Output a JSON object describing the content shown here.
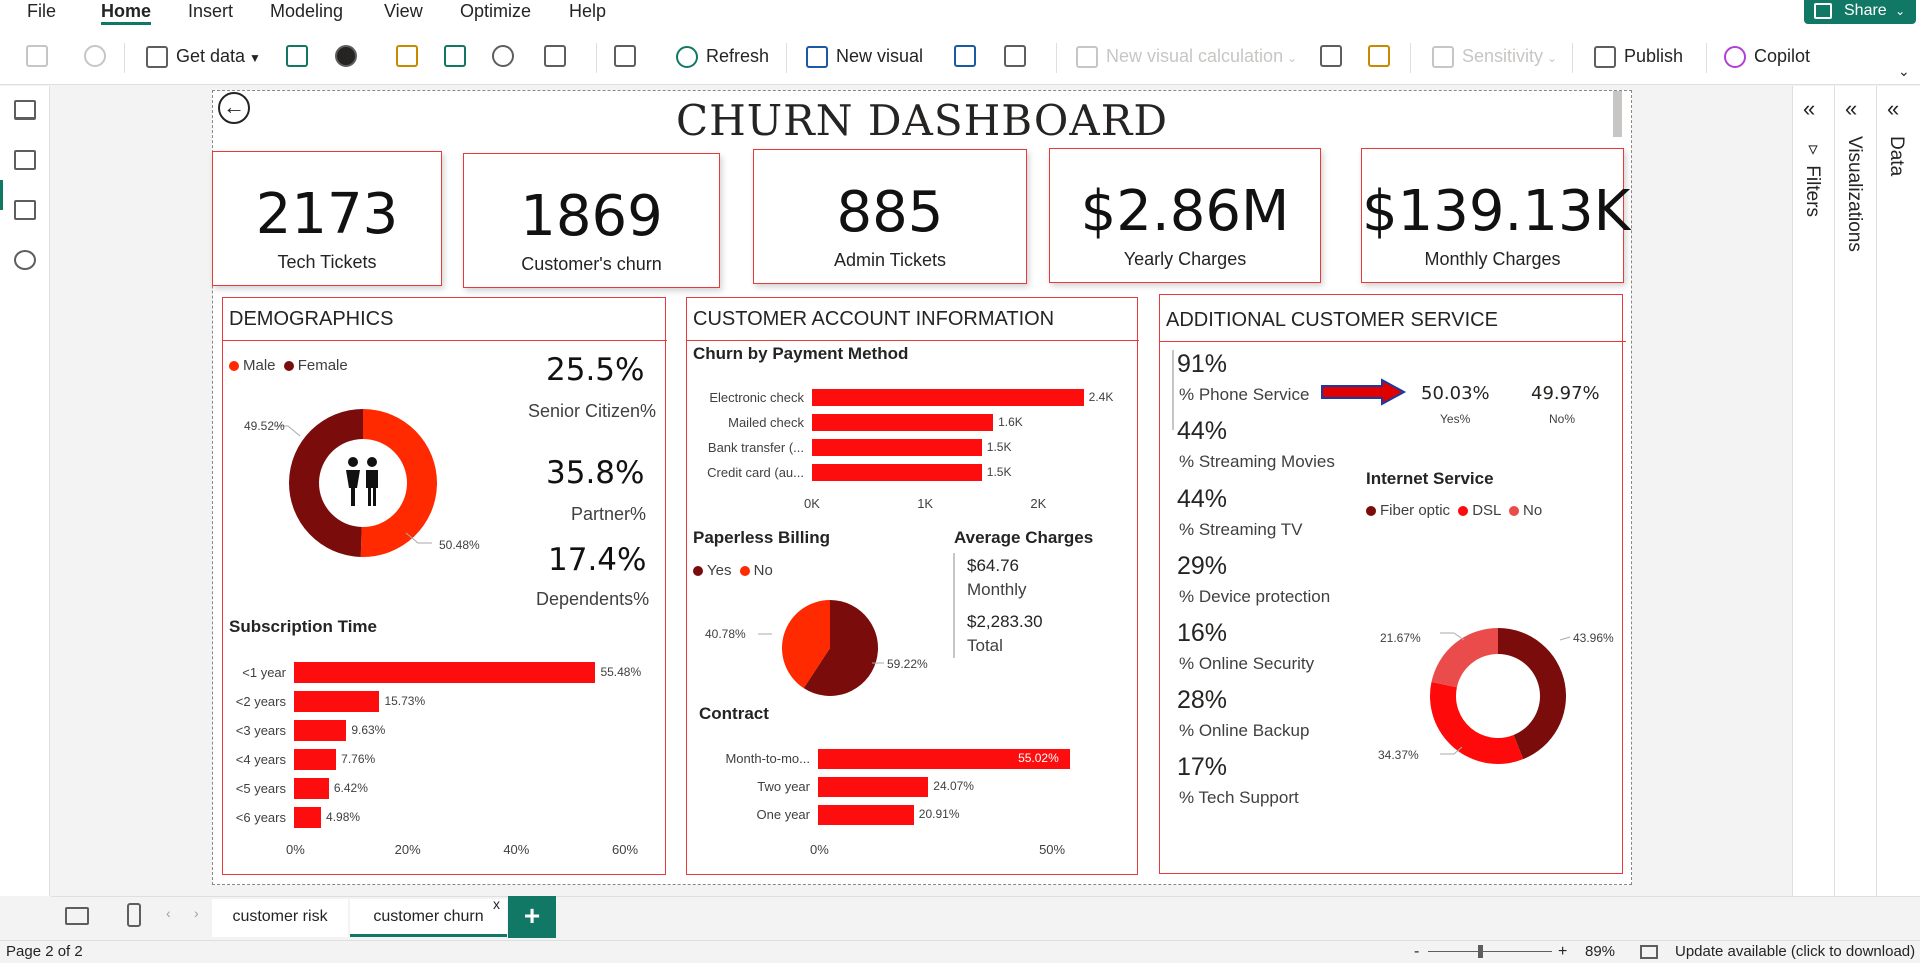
{
  "menu": [
    "File",
    "Home",
    "Insert",
    "Modeling",
    "View",
    "Optimize",
    "Help"
  ],
  "share_label": "Share",
  "ribbon": {
    "get_data": "Get data",
    "refresh": "Refresh",
    "new_visual": "New visual",
    "new_visual_calc": "New visual calculation",
    "sensitivity": "Sensitivity",
    "publish": "Publish",
    "copilot": "Copilot"
  },
  "panes": {
    "filters": "Filters",
    "visualizations": "Visualizations",
    "data": "Data"
  },
  "report": {
    "title": "CHURN DASHBOARD",
    "kpis": [
      {
        "value": "2173",
        "label": "Tech Tickets"
      },
      {
        "value": "1869",
        "label": "Customer's churn"
      },
      {
        "value": "885",
        "label": "Admin Tickets"
      },
      {
        "value": "$2.86M",
        "label": "Yearly Charges"
      },
      {
        "value": "$139.13K",
        "label": "Monthly Charges"
      }
    ],
    "demographics": {
      "title": "DEMOGRAPHICS",
      "legend": [
        "Male",
        "Female"
      ],
      "gender_pct": [
        "49.52%",
        "50.48%"
      ],
      "stats": [
        {
          "value": "25.5%",
          "label": "Senior  Citizen%"
        },
        {
          "value": "35.8%",
          "label": "Partner%"
        },
        {
          "value": "17.4%",
          "label": "Dependents%"
        }
      ],
      "subscription_title": "Subscription Time"
    },
    "account": {
      "title": "CUSTOMER ACCOUNT INFORMATION",
      "payment_title": "Churn by Payment Method",
      "paperless_title": "Paperless Billing",
      "paperless_legend": [
        "Yes",
        "No"
      ],
      "paperless_pct": [
        "40.78%",
        "59.22%"
      ],
      "avg_title": "Average Charges",
      "avg_monthly_value": "$64.76",
      "avg_monthly_label": "Monthly",
      "avg_total_value": "$2,283.30",
      "avg_total_label": "Total",
      "contract_title": "Contract"
    },
    "service": {
      "title": "ADDITIONAL  CUSTOMER SERVICE",
      "stats": [
        {
          "value": "91%",
          "label": "% Phone Service"
        },
        {
          "value": "44%",
          "label": "% Streaming Movies"
        },
        {
          "value": "44%",
          "label": "% Streaming TV"
        },
        {
          "value": "29%",
          "label": "% Device protection"
        },
        {
          "value": "16%",
          "label": "% Online Security"
        },
        {
          "value": "28%",
          "label": "% Online Backup"
        },
        {
          "value": "17%",
          "label": "% Tech Support"
        }
      ],
      "phone_yes_value": "50.03%",
      "phone_yes_label": "Yes%",
      "phone_no_value": "49.97%",
      "phone_no_label": "No%",
      "internet_title": "Internet Service",
      "internet_legend": [
        "Fiber optic",
        "DSL",
        "No"
      ],
      "internet_pct": [
        "43.96%",
        "34.37%",
        "21.67%"
      ]
    }
  },
  "chart_data": [
    {
      "type": "pie",
      "title": "",
      "categories": [
        "Male",
        "Female"
      ],
      "values": [
        50.48,
        49.52
      ],
      "colors": [
        "#ff2a00",
        "#7a0c0c"
      ]
    },
    {
      "type": "bar",
      "title": "Subscription Time",
      "categories": [
        "<1 year",
        "<2 years",
        "<3 years",
        "<4 years",
        "<5 years",
        "<6 years"
      ],
      "values": [
        55.48,
        15.73,
        9.63,
        7.76,
        6.42,
        4.98
      ],
      "labels": [
        "55.48%",
        "15.73%",
        "9.63%",
        "7.76%",
        "6.42%",
        "4.98%"
      ],
      "xlim": [
        0,
        60
      ],
      "ticks": [
        "0%",
        "20%",
        "40%",
        "60%"
      ]
    },
    {
      "type": "bar",
      "title": "Churn by Payment Method",
      "categories": [
        "Electronic check",
        "Mailed check",
        "Bank transfer (...",
        "Credit card (au..."
      ],
      "values": [
        2400,
        1600,
        1500,
        1500
      ],
      "labels": [
        "2.4K",
        "1.6K",
        "1.5K",
        "1.5K"
      ],
      "xlim": [
        0,
        2500
      ],
      "ticks": [
        "0K",
        "1K",
        "2K"
      ]
    },
    {
      "type": "pie",
      "title": "Paperless Billing",
      "categories": [
        "Yes",
        "No"
      ],
      "values": [
        59.22,
        40.78
      ],
      "colors": [
        "#7a0c0c",
        "#ff2a00"
      ]
    },
    {
      "type": "bar",
      "title": "Contract",
      "categories": [
        "Month-to-mo...",
        "Two year",
        "One year"
      ],
      "values": [
        55.02,
        24.07,
        20.91
      ],
      "labels": [
        "55.02%",
        "24.07%",
        "20.91%"
      ],
      "xlim": [
        0,
        55
      ],
      "ticks": [
        "0%",
        "50%"
      ]
    },
    {
      "type": "pie",
      "title": "Internet Service",
      "categories": [
        "Fiber optic",
        "DSL",
        "No"
      ],
      "values": [
        43.96,
        34.37,
        21.67
      ],
      "colors": [
        "#7a0c0c",
        "#ff0a0a",
        "#ea4c4c"
      ]
    }
  ],
  "tabs": [
    "customer risk",
    "customer churn"
  ],
  "tab_close": "x",
  "add_page": "+",
  "status": {
    "page": "Page 2 of 2",
    "zoom": "89%",
    "update": "Update available (click to download)"
  }
}
